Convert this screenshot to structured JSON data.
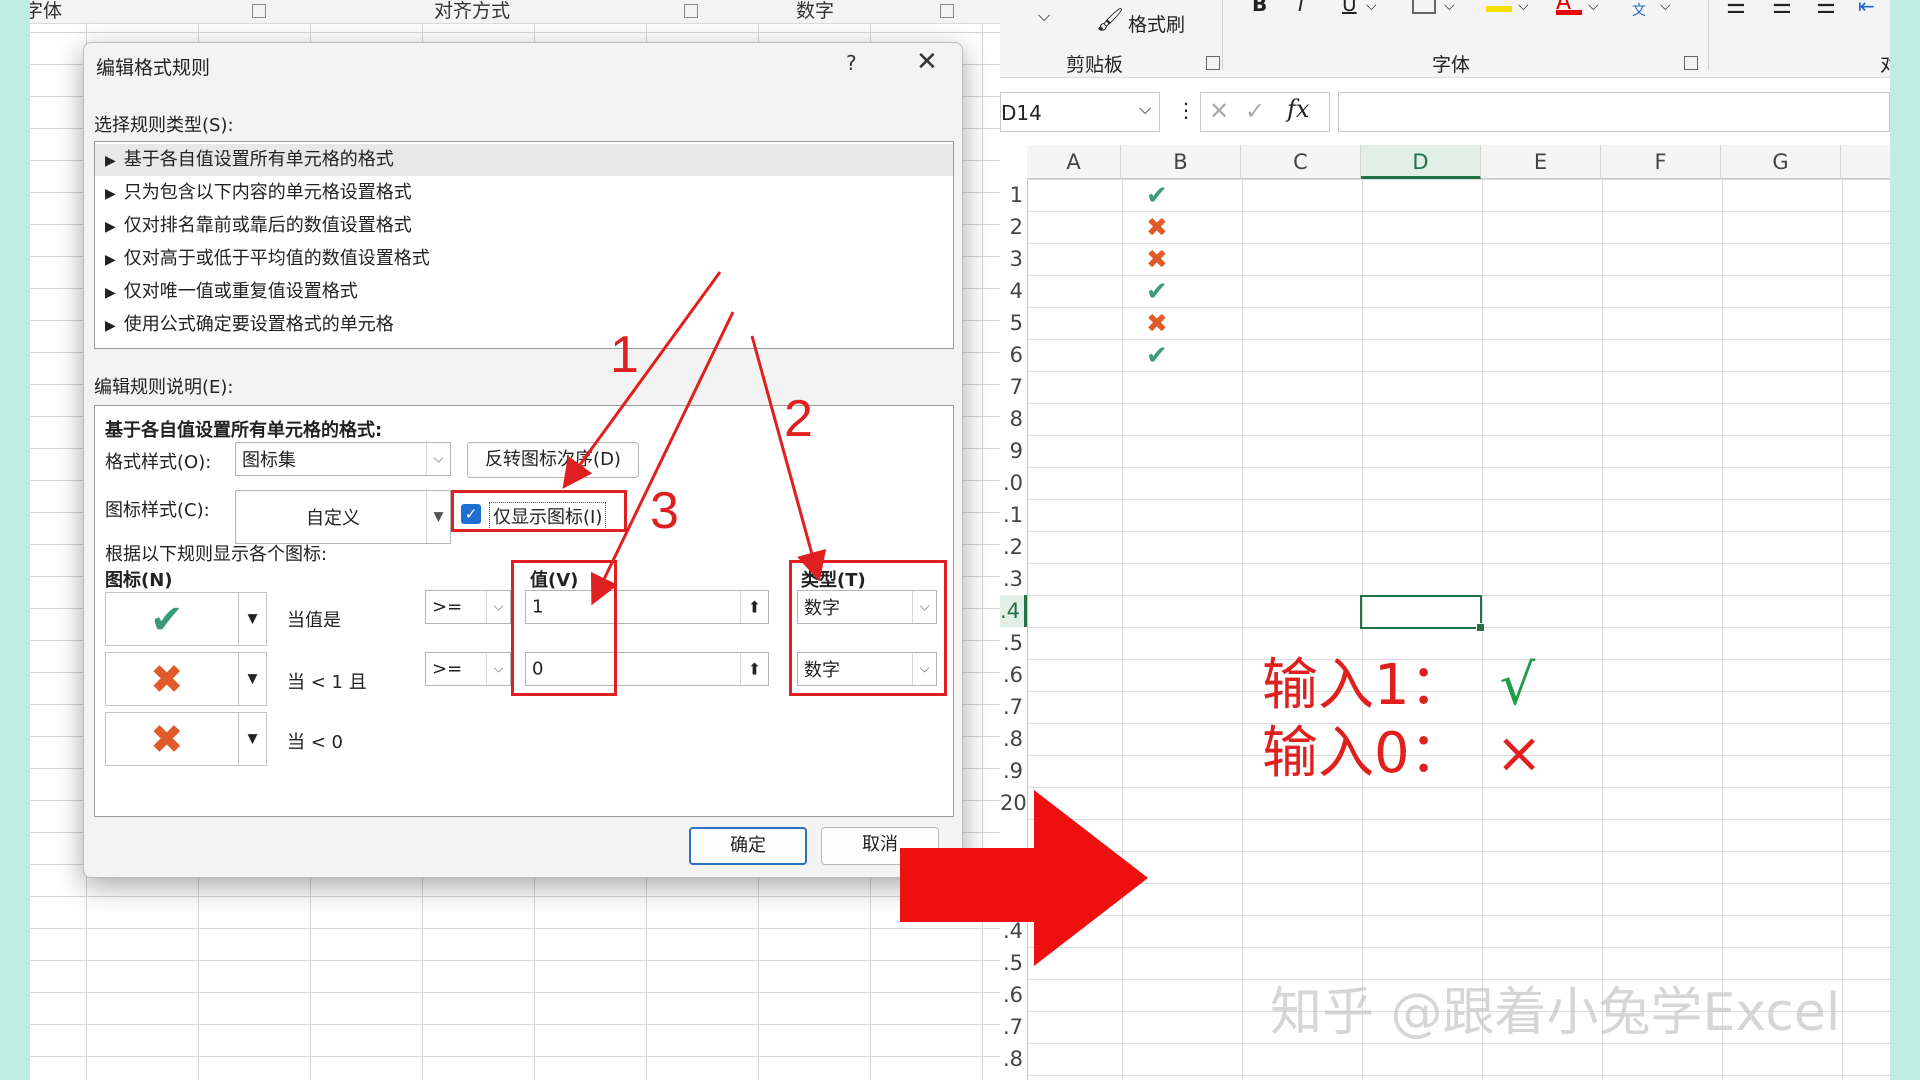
{
  "left_ribbon": {
    "group1": "字体",
    "group2": "对齐方式",
    "group3": "数字"
  },
  "dialog": {
    "title": "编辑格式规则",
    "help": "?",
    "close": "✕",
    "select_rule_type_label": "选择规则类型(S):",
    "rule_types": [
      "基于各自值设置所有单元格的格式",
      "只为包含以下内容的单元格设置格式",
      "仅对排名靠前或靠后的数值设置格式",
      "仅对高于或低于平均值的数值设置格式",
      "仅对唯一值或重复值设置格式",
      "使用公式确定要设置格式的单元格"
    ],
    "edit_rule_desc_label": "编辑规则说明(E):",
    "desc_heading": "基于各自值设置所有单元格的格式:",
    "format_style_label": "格式样式(O):",
    "format_style_value": "图标集",
    "reverse_order_button": "反转图标次序(D)",
    "icon_style_label": "图标样式(C):",
    "icon_style_value": "自定义",
    "show_icon_only_label": "仅显示图标(I)",
    "show_icon_only_checked": true,
    "rules_intro": "根据以下规则显示各个图标:",
    "icon_col_header": "图标(N)",
    "value_col_header": "值(V)",
    "type_col_header": "类型(T)",
    "rows": [
      {
        "icon": "check-icon",
        "condition": "当值是",
        "operator": ">=",
        "value": "1",
        "type": "数字"
      },
      {
        "icon": "cross-icon",
        "condition": "当 < 1 且",
        "operator": ">=",
        "value": "0",
        "type": "数字"
      },
      {
        "icon": "cross-icon",
        "condition": "当 < 0"
      }
    ],
    "ok_button": "确定",
    "cancel_button": "取消"
  },
  "annotations": {
    "n1": "1",
    "n2": "2",
    "n3": "3"
  },
  "right_ribbon": {
    "format_painter": "格式刷",
    "clipboard_group": "剪贴板",
    "font_group": "字体",
    "bold": "B",
    "italic": "I",
    "underline": "U"
  },
  "formula_bar": {
    "name_box": "D14",
    "fx": "fx",
    "formula": ""
  },
  "sheet": {
    "columns": [
      "A",
      "B",
      "C",
      "D",
      "E",
      "F",
      "G"
    ],
    "selected_column": "D",
    "row_numbers": [
      "1",
      "2",
      "3",
      "4",
      "5",
      "6",
      "7",
      "8",
      "9",
      ".0",
      ".1",
      ".2",
      ".3",
      ".4",
      ".5",
      ".6",
      ".7",
      ".8",
      ".9",
      "20",
      "",
      "",
      "",
      ".4",
      ".5",
      ".6",
      ".7",
      ".8"
    ],
    "selected_row": ".4",
    "b_column_icons": [
      "check-icon",
      "cross-icon",
      "cross-icon",
      "check-icon",
      "cross-icon",
      "check-icon"
    ],
    "note_line1_prefix": "输入1：",
    "note_line1_symbol": "√",
    "note_line2_prefix": "输入0：",
    "note_line2_symbol": "×",
    "watermark": "知乎 @跟着小兔学Excel"
  },
  "colors": {
    "check": "#3c9a7c",
    "cross": "#e05a2a",
    "annotation_red": "#e02020",
    "excel_green": "#217346"
  }
}
